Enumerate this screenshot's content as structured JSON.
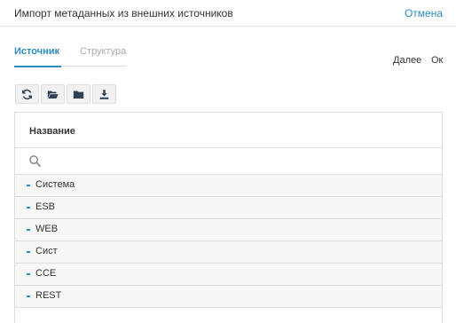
{
  "header": {
    "title": "Импорт метаданных из внешних источников",
    "cancel_label": "Отмена"
  },
  "tabs": [
    {
      "label": "Источник",
      "active": true
    },
    {
      "label": "Структура",
      "active": false
    }
  ],
  "actions": {
    "next_label": "Далее",
    "ok_label": "Ок"
  },
  "toolbar": {
    "buttons": [
      {
        "icon": "refresh-icon"
      },
      {
        "icon": "folder-open-icon"
      },
      {
        "icon": "folder-icon"
      },
      {
        "icon": "download-icon"
      }
    ]
  },
  "grid": {
    "column_header": "Название",
    "search": {
      "value": "",
      "placeholder": ""
    },
    "rows": [
      {
        "label": "Система"
      },
      {
        "label": "ESB"
      },
      {
        "label": "WEB"
      },
      {
        "label": "Сист"
      },
      {
        "label": "CCE"
      },
      {
        "label": "REST"
      }
    ]
  },
  "colors": {
    "accent": "#2e8bc0",
    "row_bg": "#f7f7f7",
    "border": "#dddddd",
    "icon_dark": "#2f4152"
  }
}
